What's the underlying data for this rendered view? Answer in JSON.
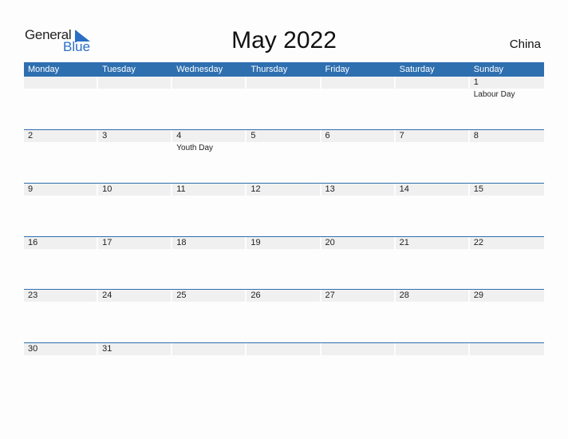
{
  "logo": {
    "general": "General",
    "blue": "Blue"
  },
  "title": "May 2022",
  "country": "China",
  "accent_color": "#2e6fb0",
  "weekdays": [
    "Monday",
    "Tuesday",
    "Wednesday",
    "Thursday",
    "Friday",
    "Saturday",
    "Sunday"
  ],
  "weeks": [
    [
      {
        "d": ""
      },
      {
        "d": ""
      },
      {
        "d": ""
      },
      {
        "d": ""
      },
      {
        "d": ""
      },
      {
        "d": ""
      },
      {
        "d": "1",
        "h": "Labour Day"
      }
    ],
    [
      {
        "d": "2"
      },
      {
        "d": "3"
      },
      {
        "d": "4",
        "h": "Youth Day"
      },
      {
        "d": "5"
      },
      {
        "d": "6"
      },
      {
        "d": "7"
      },
      {
        "d": "8"
      }
    ],
    [
      {
        "d": "9"
      },
      {
        "d": "10"
      },
      {
        "d": "11"
      },
      {
        "d": "12"
      },
      {
        "d": "13"
      },
      {
        "d": "14"
      },
      {
        "d": "15"
      }
    ],
    [
      {
        "d": "16"
      },
      {
        "d": "17"
      },
      {
        "d": "18"
      },
      {
        "d": "19"
      },
      {
        "d": "20"
      },
      {
        "d": "21"
      },
      {
        "d": "22"
      }
    ],
    [
      {
        "d": "23"
      },
      {
        "d": "24"
      },
      {
        "d": "25"
      },
      {
        "d": "26"
      },
      {
        "d": "27"
      },
      {
        "d": "28"
      },
      {
        "d": "29"
      }
    ],
    [
      {
        "d": "30"
      },
      {
        "d": "31"
      },
      {
        "d": ""
      },
      {
        "d": ""
      },
      {
        "d": ""
      },
      {
        "d": ""
      },
      {
        "d": ""
      }
    ]
  ]
}
